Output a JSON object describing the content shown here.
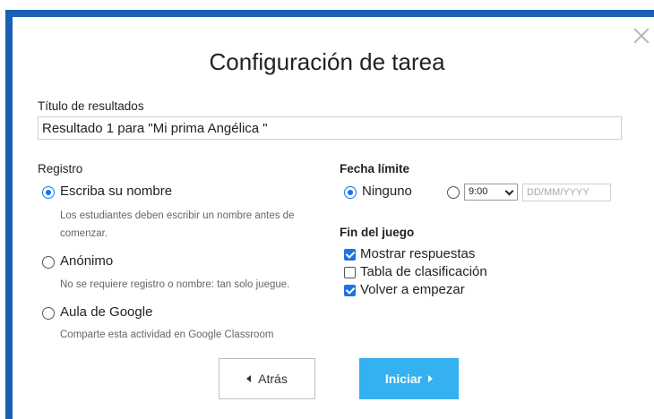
{
  "dialog": {
    "title": "Configuración de tarea"
  },
  "results": {
    "label": "Título de resultados",
    "value": "Resultado 1 para \"Mi prima Angélica \""
  },
  "registro": {
    "label": "Registro",
    "options": [
      {
        "label": "Escriba su nombre",
        "hint": "Los estudiantes deben escribir un nombre antes de comenzar.",
        "selected": true
      },
      {
        "label": "Anónimo",
        "hint": "No se requiere registro o nombre: tan solo juegue.",
        "selected": false
      },
      {
        "label": "Aula de Google",
        "hint": "Comparte esta actividad en Google Classroom",
        "selected": false
      }
    ]
  },
  "deadline": {
    "label": "Fecha límite",
    "none_label": "Ninguno",
    "none_selected": true,
    "time_value": "9:00",
    "date_placeholder": "DD/MM/YYYY"
  },
  "end_game": {
    "label": "Fin del juego",
    "options": [
      {
        "label": "Mostrar respuestas",
        "checked": true
      },
      {
        "label": "Tabla de clasificación",
        "checked": false
      },
      {
        "label": "Volver a empezar",
        "checked": true
      }
    ]
  },
  "buttons": {
    "back_label": "Atrás",
    "start_label": "Iniciar"
  },
  "colors": {
    "frame_accent": "#1a5fb4",
    "primary": "#35b0f0",
    "check_blue": "#1a73e8"
  }
}
